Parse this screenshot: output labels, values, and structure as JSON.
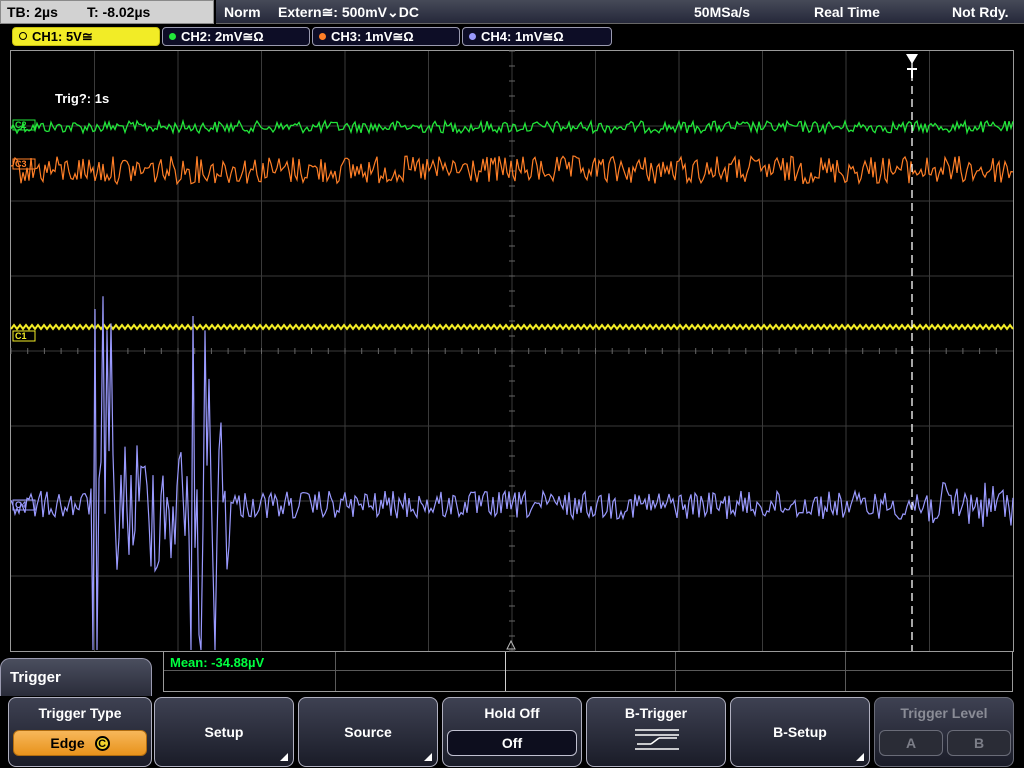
{
  "status": {
    "timebase": "TB: 2µs",
    "trigger_time": "T: -8.02µs",
    "mode": "Norm",
    "trigger_source": "Extern≅: 500mV⌄DC",
    "sample_rate": "50MSa/s",
    "acq_mode": "Real Time",
    "ready": "Not Rdy."
  },
  "channels": [
    {
      "label": "CH1: 5V≅",
      "color": "#f2ec26",
      "active": true
    },
    {
      "label": "CH2: 2mV≅Ω",
      "color": "#22e63a",
      "active": false
    },
    {
      "label": "CH3: 1mV≅Ω",
      "color": "#ff7f27",
      "active": false
    },
    {
      "label": "CH4: 1mV≅Ω",
      "color": "#9a9aff",
      "active": false
    }
  ],
  "grid": {
    "trig_info": "Trig?: 1s",
    "marker_labels": [
      "C2",
      "C3",
      "C1",
      "C4"
    ]
  },
  "measurement": {
    "label": "Mean: -34.88µV"
  },
  "menu": {
    "title": "Trigger",
    "softkeys": [
      {
        "label": "Trigger Type",
        "value": "Edge",
        "value_icon": "C"
      },
      {
        "label": "Setup"
      },
      {
        "label": "Source"
      },
      {
        "label": "Hold Off",
        "value": "Off"
      },
      {
        "label": "B-Trigger"
      },
      {
        "label": "B-Setup"
      },
      {
        "label": "Trigger Level",
        "a": "A",
        "b": "B"
      }
    ]
  },
  "colors": {
    "ch1": "#f2ec26",
    "ch2": "#22e63a",
    "ch3": "#ff7f27",
    "ch4": "#9a9aff",
    "grid": "#3a3a3a",
    "cursor": "#ffffff"
  }
}
